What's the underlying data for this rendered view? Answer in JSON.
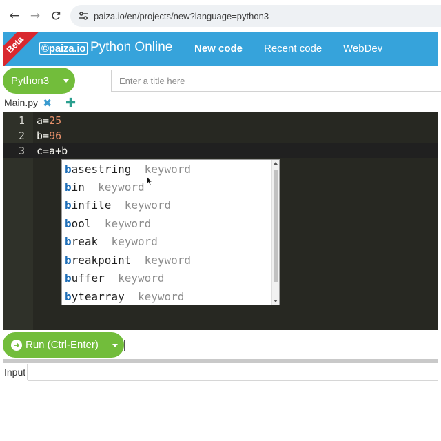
{
  "browser": {
    "url": "paiza.io/en/projects/new?language=python3"
  },
  "header": {
    "beta": "Beta",
    "logo": "©paiza.io",
    "title": "Python Online",
    "nav": [
      "New code",
      "Recent code",
      "WebDev"
    ],
    "bg_color": "#36a3db"
  },
  "toolbar": {
    "language": "Python3",
    "title_placeholder": "Enter a title here",
    "accent_color": "#72bd3b"
  },
  "files": {
    "active": "Main.py"
  },
  "editor": {
    "lines": [
      {
        "n": "1",
        "pre": "a=",
        "num": "25"
      },
      {
        "n": "2",
        "pre": "b=",
        "num": "96"
      },
      {
        "n": "3",
        "pre": "c=a+b",
        "num": ""
      }
    ]
  },
  "autocomplete": {
    "items": [
      {
        "head": "b",
        "rest": "asestring",
        "meta": "keyword"
      },
      {
        "head": "b",
        "rest": "in",
        "meta": "keyword"
      },
      {
        "head": "b",
        "rest": "infile",
        "meta": "keyword"
      },
      {
        "head": "b",
        "rest": "ool",
        "meta": "keyword"
      },
      {
        "head": "b",
        "rest": "reak",
        "meta": "keyword"
      },
      {
        "head": "b",
        "rest": "reakpoint",
        "meta": "keyword"
      },
      {
        "head": "b",
        "rest": "uffer",
        "meta": "keyword"
      },
      {
        "head": "b",
        "rest": "ytearray",
        "meta": "keyword"
      }
    ]
  },
  "run": {
    "label": "Run (Ctrl-Enter)"
  },
  "io": {
    "tab": "Input"
  }
}
